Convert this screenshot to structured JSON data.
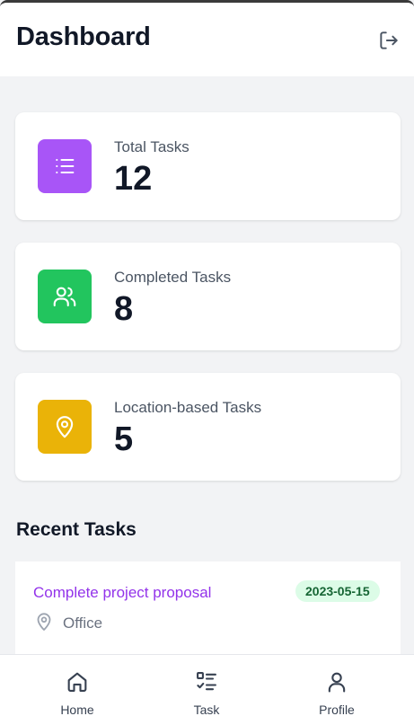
{
  "header": {
    "title": "Dashboard",
    "logout_icon": "logout-icon"
  },
  "stats": [
    {
      "label": "Total Tasks",
      "value": "12",
      "icon": "list-icon",
      "color": "#a855f7"
    },
    {
      "label": "Completed Tasks",
      "value": "8",
      "icon": "users-icon",
      "color": "#22c55e"
    },
    {
      "label": "Location-based Tasks",
      "value": "5",
      "icon": "map-pin-icon",
      "color": "#eab308"
    }
  ],
  "recent": {
    "title": "Recent Tasks",
    "tasks": [
      {
        "title": "Complete project proposal",
        "date": "2023-05-15",
        "location": "Office"
      }
    ]
  },
  "nav": {
    "items": [
      {
        "label": "Home",
        "icon": "home-icon"
      },
      {
        "label": "Task",
        "icon": "task-list-icon"
      },
      {
        "label": "Profile",
        "icon": "user-icon"
      }
    ]
  },
  "colors": {
    "accent_purple": "#9333ea",
    "date_badge_bg": "#dcfce7",
    "date_badge_text": "#166534",
    "page_bg": "#f2f3f5"
  }
}
